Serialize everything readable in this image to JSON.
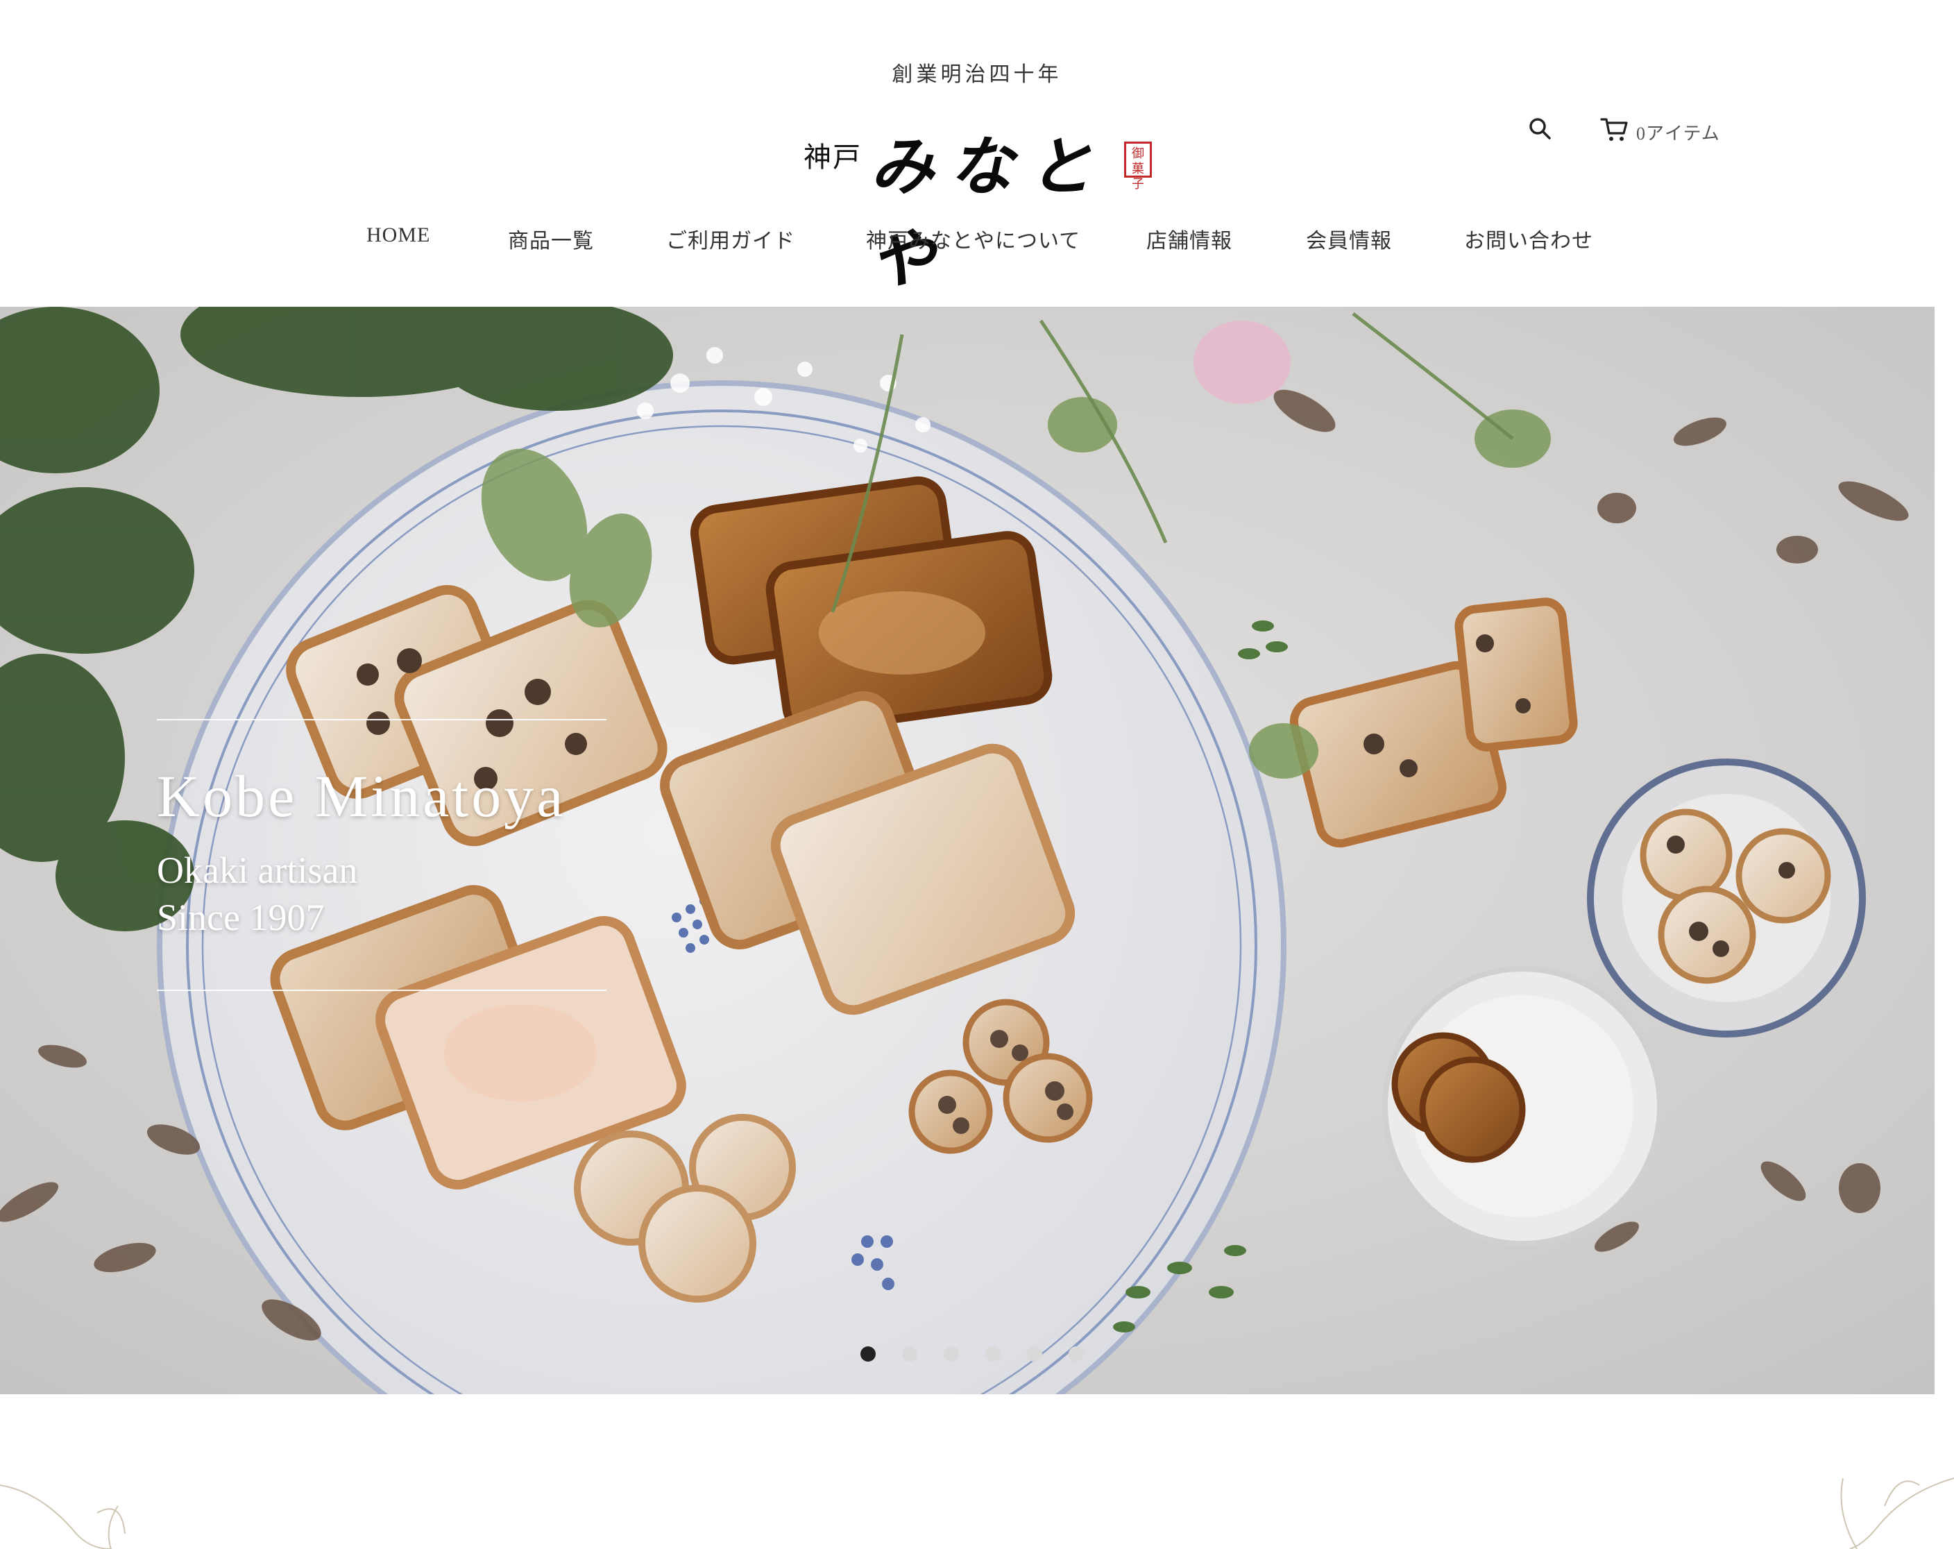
{
  "header": {
    "tagline": "創業明治四十年",
    "logo": {
      "prefix": "神戸",
      "name": "みなとや",
      "seal": "御菓子"
    },
    "cart_label": "0アイテム"
  },
  "nav": {
    "items": [
      {
        "label": "HOME"
      },
      {
        "label": "商品一覧"
      },
      {
        "label": "ご利用ガイド"
      },
      {
        "label": "神戸みなとやについて"
      },
      {
        "label": "店舗情報"
      },
      {
        "label": "会員情報"
      },
      {
        "label": "お問い合わせ"
      }
    ]
  },
  "hero": {
    "title": "Kobe Minatoya",
    "subtitle_line1": "Okaki artisan",
    "subtitle_line2": "Since 1907",
    "slide_count": 6,
    "active_slide": 1
  },
  "colors": {
    "accent_seal": "#c22a2a",
    "text": "#333333",
    "dot_active": "#222222",
    "dot_inactive": "#d9d9d9"
  }
}
